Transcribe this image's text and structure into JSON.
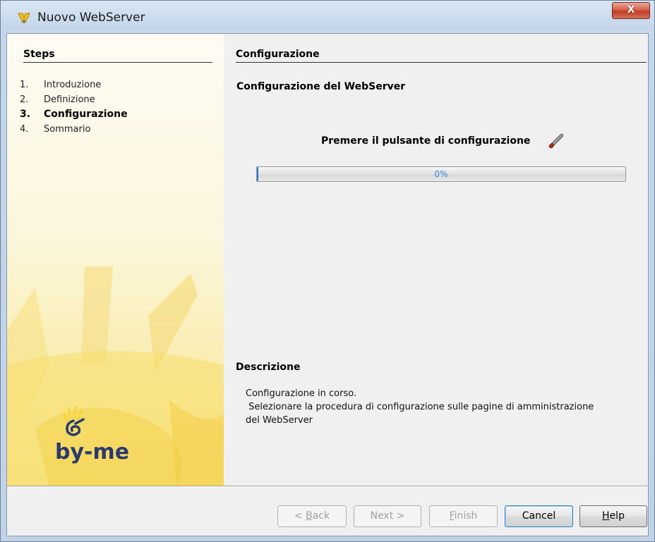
{
  "window": {
    "title": "Nuovo WebServer",
    "close_label": "X"
  },
  "steps": {
    "title": "Steps",
    "items": [
      {
        "num": "1.",
        "label": "Introduzione",
        "current": false
      },
      {
        "num": "2.",
        "label": "Definizione",
        "current": false
      },
      {
        "num": "3.",
        "label": "Configurazione",
        "current": true
      },
      {
        "num": "4.",
        "label": "Sommario",
        "current": false
      }
    ]
  },
  "logo": {
    "text": "by-me"
  },
  "main": {
    "title": "Configurazione",
    "subtitle": "Configurazione del WebServer",
    "instruction": "Premere il pulsante di configurazione",
    "progress": {
      "value": 0,
      "label": "0%"
    },
    "description_title": "Descrizione",
    "description_text": "Configurazione in corso.\n Selezionare la procedura di configurazione sulle pagine di amministrazione\ndel WebServer"
  },
  "buttons": {
    "back": {
      "prefix": "< ",
      "mnemonic": "B",
      "rest": "ack"
    },
    "next": {
      "label": "Next >"
    },
    "finish": {
      "mnemonic": "F",
      "rest": "inish"
    },
    "cancel": {
      "label": "Cancel"
    },
    "help": {
      "mnemonic": "H",
      "rest": "elp"
    }
  }
}
